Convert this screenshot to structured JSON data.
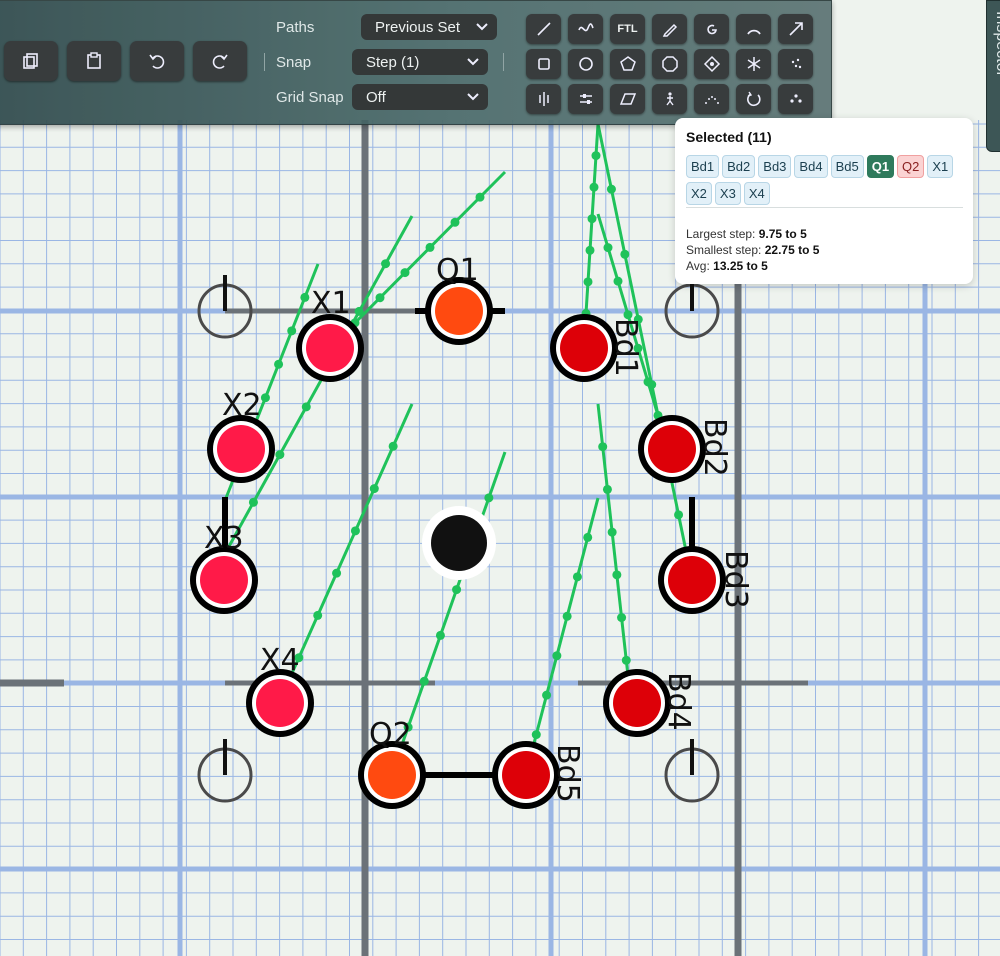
{
  "toolbar": {
    "paths_label": "Paths",
    "paths_value": "Previous Set",
    "snap_label": "Snap",
    "snap_value": "Step (1)",
    "grid_snap_label": "Grid Snap",
    "grid_snap_value": "Off",
    "ftl_label": "FTL",
    "buttons": [
      "copy-icon",
      "paste-icon",
      "undo-icon",
      "redo-icon"
    ],
    "tools_row1": [
      "line-icon",
      "curve-icon",
      "ftl-tool",
      "pencil-icon",
      "spiral-icon",
      "arc-icon",
      "arrow-icon"
    ],
    "tools_row2": [
      "square-icon",
      "circle-icon",
      "pentagon-icon",
      "octagon-icon",
      "diamond-icon",
      "asterisk-icon",
      "scatter-icon"
    ],
    "tools_row3": [
      "mirror-icon",
      "align-icon",
      "parallelogram-icon",
      "person-icon",
      "dotted-arc-icon",
      "rotate-icon",
      "cluster-icon"
    ]
  },
  "inspector": {
    "label": "Inspector"
  },
  "selection": {
    "title": "Selected (11)",
    "chips": [
      "Bd1",
      "Bd2",
      "Bd3",
      "Bd4",
      "Bd5",
      "Q1",
      "Q2",
      "X1",
      "X2",
      "X3",
      "X4"
    ],
    "largest_label": "Largest step:",
    "largest_value": "9.75 to 5",
    "smallest_label": "Smallest step:",
    "smallest_value": "22.75 to 5",
    "avg_label": "Avg:",
    "avg_value": "13.25 to 5"
  },
  "field": {
    "players": [
      {
        "id": "Q1",
        "color": "#ff4a10"
      },
      {
        "id": "X1",
        "color": "#ff1a48"
      },
      {
        "id": "X2",
        "color": "#ff1a48"
      },
      {
        "id": "X3",
        "color": "#ff1a48"
      },
      {
        "id": "X4",
        "color": "#ff1a48"
      },
      {
        "id": "Q2",
        "color": "#ff4a10"
      },
      {
        "id": "Bd1",
        "color": "#dd0008"
      },
      {
        "id": "Bd2",
        "color": "#dd0008"
      },
      {
        "id": "Bd3",
        "color": "#dd0008"
      },
      {
        "id": "Bd4",
        "color": "#dd0008"
      },
      {
        "id": "Bd5",
        "color": "#dd0008"
      }
    ],
    "path_color": "#1fc25a",
    "grid_color": "#9ab6e4"
  }
}
